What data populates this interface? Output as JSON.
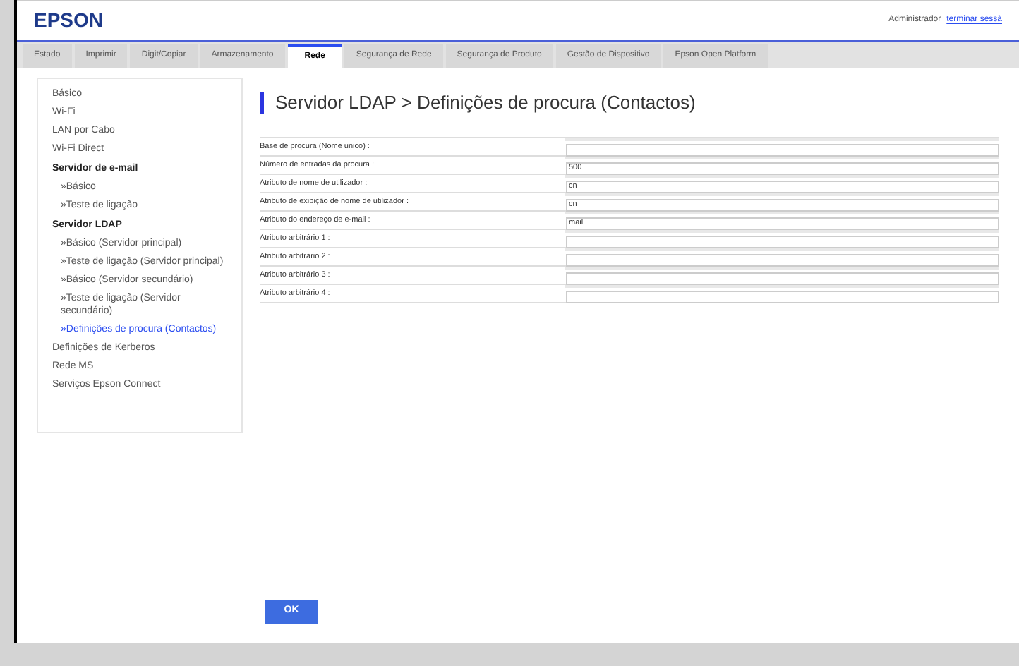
{
  "header": {
    "logo": "EPSON",
    "user": "Administrador",
    "logout_link": "terminar sessã"
  },
  "tabs": [
    {
      "label": "Estado",
      "selected": false
    },
    {
      "label": "Imprimir",
      "selected": false
    },
    {
      "label": "Digit/Copiar",
      "selected": false
    },
    {
      "label": "Armazenamento",
      "selected": false
    },
    {
      "label": "Rede",
      "selected": true
    },
    {
      "label": "Segurança de Rede",
      "selected": false
    },
    {
      "label": "Segurança de Produto",
      "selected": false
    },
    {
      "label": "Gestão de Dispositivo",
      "selected": false
    },
    {
      "label": "Epson Open Platform",
      "selected": false
    }
  ],
  "sidebar": {
    "items": [
      {
        "label": "Básico",
        "kind": "link",
        "selected": false
      },
      {
        "label": "Wi-Fi",
        "kind": "link",
        "selected": false
      },
      {
        "label": "LAN por Cabo",
        "kind": "link",
        "selected": false
      },
      {
        "label": "Wi-Fi Direct",
        "kind": "link",
        "selected": false
      },
      {
        "label": "Servidor de e-mail",
        "kind": "group",
        "children": [
          {
            "label": "»Básico",
            "selected": false
          },
          {
            "label": "»Teste de ligação",
            "selected": false
          }
        ]
      },
      {
        "label": "Servidor LDAP",
        "kind": "group",
        "children": [
          {
            "label": "»Básico (Servidor principal)",
            "selected": false
          },
          {
            "label": "»Teste de ligação (Servidor principal)",
            "selected": false
          },
          {
            "label": "»Básico (Servidor secundário)",
            "selected": false
          },
          {
            "label": "»Teste de ligação (Servidor secundário)",
            "selected": false
          },
          {
            "label": "»Definições de procura (Contactos)",
            "selected": true
          }
        ]
      },
      {
        "label": "Definições de Kerberos",
        "kind": "link",
        "selected": false
      },
      {
        "label": "Rede MS",
        "kind": "link",
        "selected": false
      },
      {
        "label": "Serviços Epson Connect",
        "kind": "link",
        "selected": false
      }
    ]
  },
  "page_title": "Servidor LDAP > Definições de procura (Contactos)",
  "form": {
    "rows": [
      {
        "label": "Base de procura (Nome único) :",
        "value": ""
      },
      {
        "label": "Número de entradas da procura :",
        "value": "500"
      },
      {
        "label": "Atributo de nome de utilizador :",
        "value": "cn"
      },
      {
        "label": "Atributo de exibição de nome de utilizador :",
        "value": "cn"
      },
      {
        "label": "Atributo do endereço de e-mail :",
        "value": "mail"
      },
      {
        "label": "Atributo arbitrário 1 :",
        "value": ""
      },
      {
        "label": "Atributo arbitrário 2 :",
        "value": ""
      },
      {
        "label": "Atributo arbitrário 3 :",
        "value": ""
      },
      {
        "label": "Atributo arbitrário 4 :",
        "value": ""
      }
    ]
  },
  "ok_button": "OK"
}
